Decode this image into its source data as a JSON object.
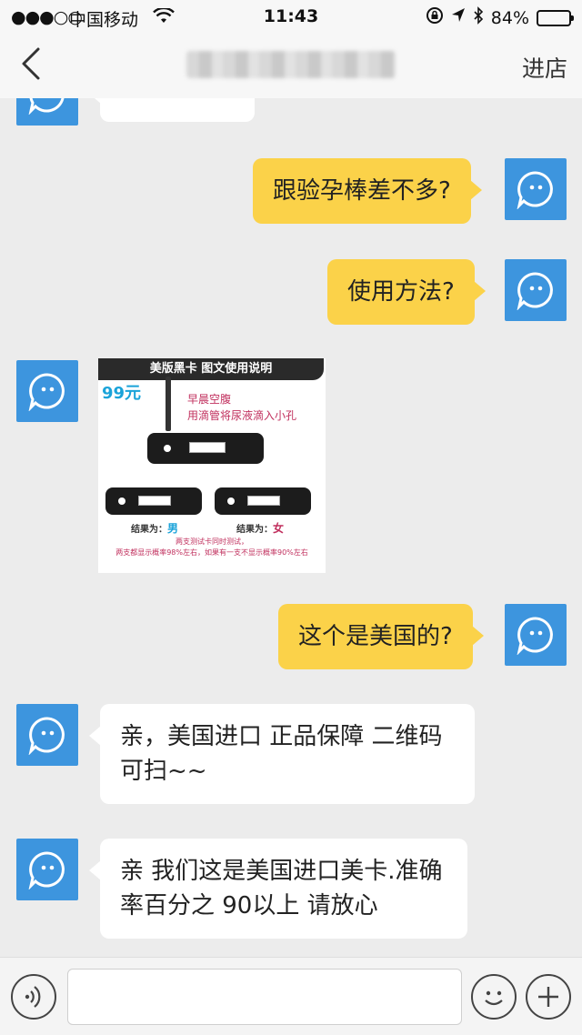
{
  "status_bar": {
    "signal": "●●●○○",
    "carrier": "中国移动",
    "time": "11:43",
    "battery": "84%"
  },
  "nav": {
    "enter_store": "进店"
  },
  "messages": {
    "m1": "跟验孕棒差不多?",
    "m2": "使用方法?",
    "m3": "这个是美国的?",
    "m4_line1": "亲，美国进口  正品保障 二维码",
    "m4_line2": "可扫~~",
    "m5_line1": "亲 我们这是美国进口美卡.准确",
    "m5_line2": "率百分之 90以上  请放心"
  },
  "image_message": {
    "header": "美版黑卡 图文使用说明",
    "price": "99元",
    "step1": "早晨空腹",
    "step2": "用滴管将尿液滴入小孔",
    "result_label": "结果为：",
    "result_male": "男",
    "result_female": "女",
    "note1": "两支测试卡同时测试，",
    "note2": "两支都显示概率98%左右，如果有一支不显示概率90%左右"
  },
  "colors": {
    "my_bubble": "#fbd249",
    "their_bubble": "#ffffff",
    "avatar": "#3d95de",
    "background": "#ececec"
  },
  "input": {
    "placeholder": ""
  }
}
